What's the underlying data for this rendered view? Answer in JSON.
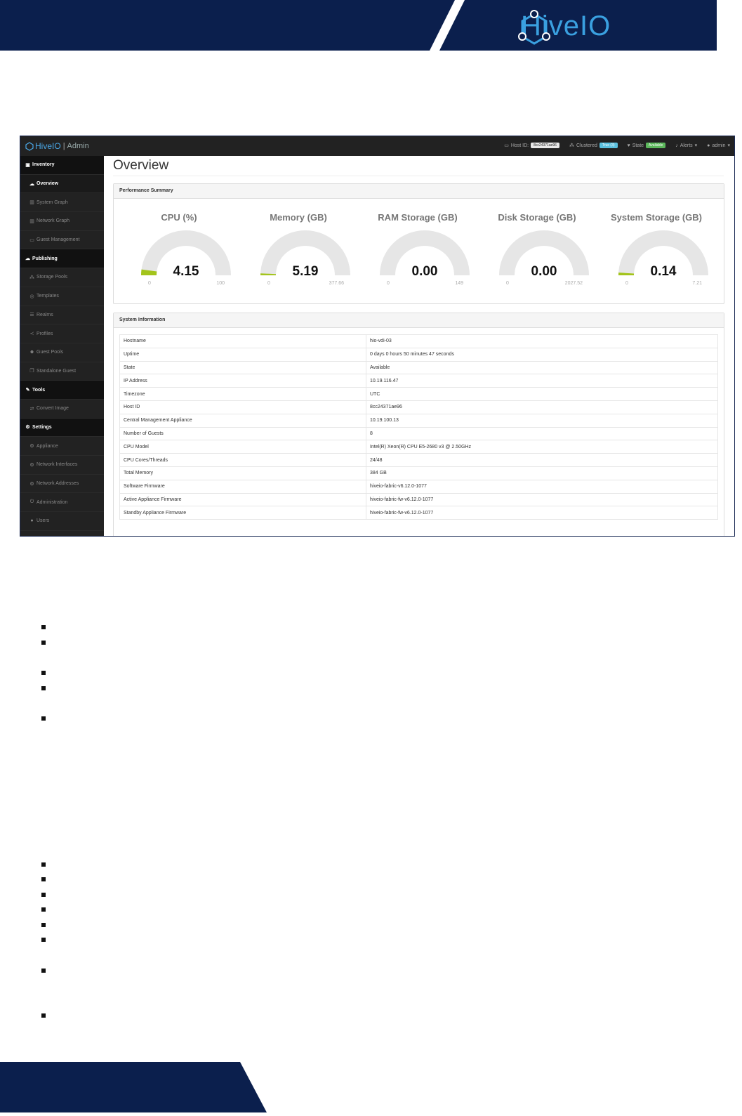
{
  "brand": {
    "name": "HiveIO"
  },
  "app": {
    "brand_logo": "HiveIO",
    "brand_suffix": "Admin",
    "nav": {
      "host_id_label": "Host ID:",
      "host_id_value": "8cc24371ae96",
      "clustered_label": "Clustered",
      "clustered_value": "True (3)",
      "state_label": "State",
      "state_value": "Available",
      "alerts_label": "Alerts",
      "user_label": "admin"
    },
    "sidebar": [
      {
        "label": "Inventory",
        "type": "section",
        "icon": "inventory-icon"
      },
      {
        "label": "Overview",
        "type": "active",
        "icon": "cloud-icon"
      },
      {
        "label": "System Graph",
        "type": "item",
        "icon": "chart-icon"
      },
      {
        "label": "Network Graph",
        "type": "item",
        "icon": "chart-icon"
      },
      {
        "label": "Guest Management",
        "type": "item",
        "icon": "monitor-icon"
      },
      {
        "label": "Publishing",
        "type": "section",
        "icon": "cloud-icon"
      },
      {
        "label": "Storage Pools",
        "type": "item",
        "icon": "sitemap-icon"
      },
      {
        "label": "Templates",
        "type": "item",
        "icon": "template-icon"
      },
      {
        "label": "Realms",
        "type": "item",
        "icon": "list-icon"
      },
      {
        "label": "Profiles",
        "type": "item",
        "icon": "share-icon"
      },
      {
        "label": "Guest Pools",
        "type": "item",
        "icon": "users-icon"
      },
      {
        "label": "Standalone Guest",
        "type": "item",
        "icon": "copy-icon"
      },
      {
        "label": "Tools",
        "type": "section",
        "icon": "wrench-icon"
      },
      {
        "label": "Convert Image",
        "type": "item",
        "icon": "exchange-icon"
      },
      {
        "label": "Settings",
        "type": "section",
        "icon": "cogs-icon"
      },
      {
        "label": "Appliance",
        "type": "item",
        "icon": "gear-icon"
      },
      {
        "label": "Network Interfaces",
        "type": "item",
        "icon": "gear-icon"
      },
      {
        "label": "Network Addresses",
        "type": "item",
        "icon": "gear-icon"
      },
      {
        "label": "Administration",
        "type": "item",
        "icon": "power-icon"
      },
      {
        "label": "Users",
        "type": "item",
        "icon": "user-icon"
      }
    ],
    "page_title": "Overview",
    "performance": {
      "heading": "Performance Summary",
      "gauges": [
        {
          "title": "CPU (%)",
          "value": "4.15",
          "min": "0",
          "max": "100",
          "fraction": 0.0415
        },
        {
          "title": "Memory (GB)",
          "value": "5.19",
          "min": "0",
          "max": "377.66",
          "fraction": 0.0137
        },
        {
          "title": "RAM Storage (GB)",
          "value": "0.00",
          "min": "0",
          "max": "149",
          "fraction": 0
        },
        {
          "title": "Disk Storage (GB)",
          "value": "0.00",
          "min": "0",
          "max": "2027.52",
          "fraction": 0
        },
        {
          "title": "System Storage (GB)",
          "value": "0.14",
          "min": "0",
          "max": "7.21",
          "fraction": 0.0194
        }
      ],
      "gauge_fill_color": "#a3c41c",
      "gauge_track_color": "#e6e6e6"
    },
    "system_info": {
      "heading": "System Information",
      "rows": [
        [
          "Hostname",
          "hio-vdi-03"
        ],
        [
          "Uptime",
          "0 days 0 hours 50 minutes 47 seconds"
        ],
        [
          "State",
          "Available"
        ],
        [
          "IP Address",
          "10.19.116.47"
        ],
        [
          "Timezone",
          "UTC"
        ],
        [
          "Host ID",
          "8cc24371ae96"
        ],
        [
          "Central Management Appliance",
          "10.19.100.13"
        ],
        [
          "Number of Guests",
          "8"
        ],
        [
          "CPU Model",
          "Intel(R) Xeon(R) CPU E5-2680 v3 @ 2.50GHz"
        ],
        [
          "CPU Cores/Threads",
          "24/48"
        ],
        [
          "Total Memory",
          "384 GB"
        ],
        [
          "Software Firmware",
          "hiveio-fabric-v6.12.0-1077"
        ],
        [
          "Active Appliance Firmware",
          "hiveio-fabric-fw-v6.12.0-1077"
        ],
        [
          "Standby Appliance Firmware",
          "hiveio-fabric-fw-v6.12.0-1077"
        ]
      ]
    }
  },
  "colors": {
    "banner_navy": "#0b1f4d",
    "brand_blue": "#3aa0e0"
  }
}
